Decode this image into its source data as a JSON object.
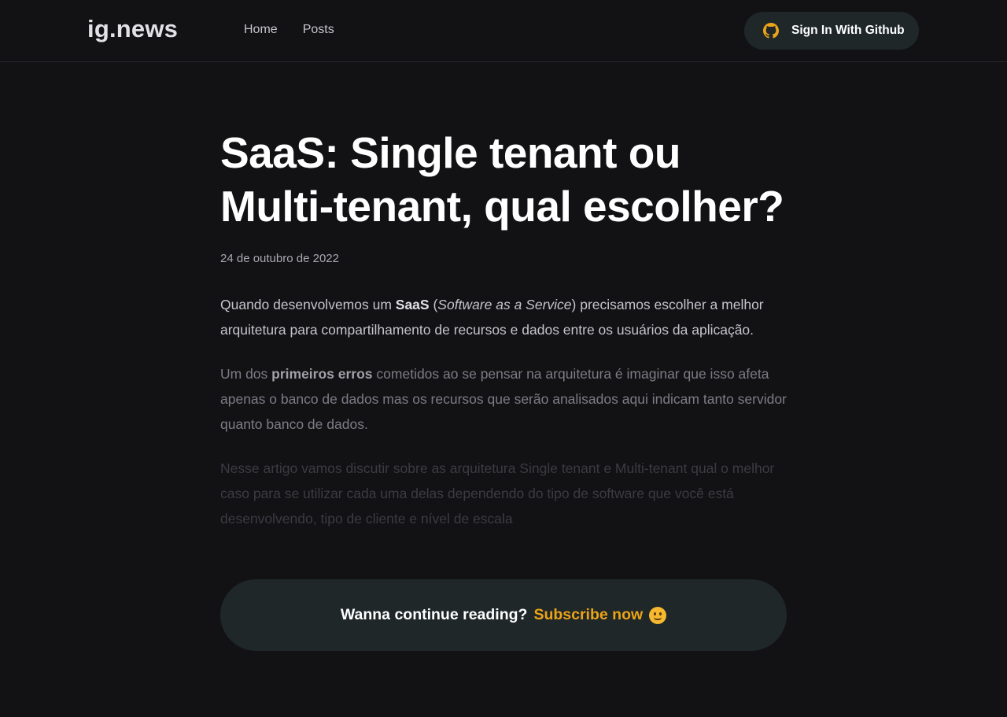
{
  "header": {
    "logo": "ig.news",
    "nav": [
      "Home",
      "Posts"
    ],
    "signin_label": "Sign In With Github",
    "signin_icon": "github-icon",
    "signin_icon_color": "#eba417"
  },
  "post": {
    "title": "SaaS: Single tenant ou Multi-tenant, qual escolher?",
    "date": "24 de outubro de 2022",
    "paragraphs": [
      {
        "before": "Quando desenvolvemos um ",
        "bold": "SaaS",
        "middle": " (",
        "italic": "Software as a Service",
        "after": ") precisamos escolher a melhor arquitetura para compartilhamento de recursos e dados entre os usuários da aplicação."
      },
      {
        "before": "Um dos ",
        "bold": "primeiros erros",
        "after": " cometidos ao se pensar na arquitetura é imaginar que isso afeta apenas o banco de dados mas os recursos que serão analisados aqui indicam tanto servidor quanto banco de dados."
      },
      {
        "text": "Nesse artigo vamos discutir sobre as arquitetura Single tenant e Multi-tenant qual o melhor caso para se utilizar cada uma delas dependendo do tipo de software que você está desenvolvendo, tipo de cliente e nível de escala"
      }
    ]
  },
  "cta": {
    "question": "Wanna continue reading?",
    "link": "Subscribe now",
    "emoji": "hugging-face-icon",
    "accent": "#eba417"
  }
}
